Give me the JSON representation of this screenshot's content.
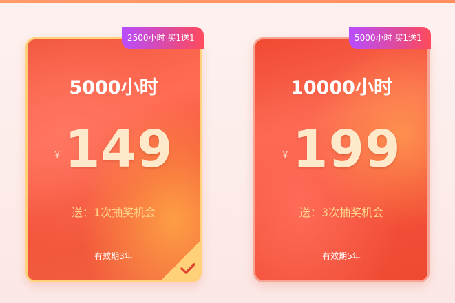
{
  "plans": [
    {
      "badge": "2500小时 买1送1",
      "hours": "5000小时",
      "currency": "¥",
      "price": "149",
      "bonus": "送：1次抽奖机会",
      "validity": "有效期3年",
      "selected": true
    },
    {
      "badge": "5000小时 买1送1",
      "hours": "10000小时",
      "currency": "¥",
      "price": "199",
      "bonus": "送：3次抽奖机会",
      "validity": "有效期5年",
      "selected": false
    }
  ],
  "icons": {
    "selected_check": "checkmark-icon"
  },
  "colors": {
    "card_selected_border": "#ffd27a",
    "card_border": "#f8a494",
    "badge_gradient_start": "#b84dff",
    "badge_gradient_end": "#ff4b5c",
    "bonus_text": "#ffd58c",
    "price_text": "#ffe9cb"
  }
}
